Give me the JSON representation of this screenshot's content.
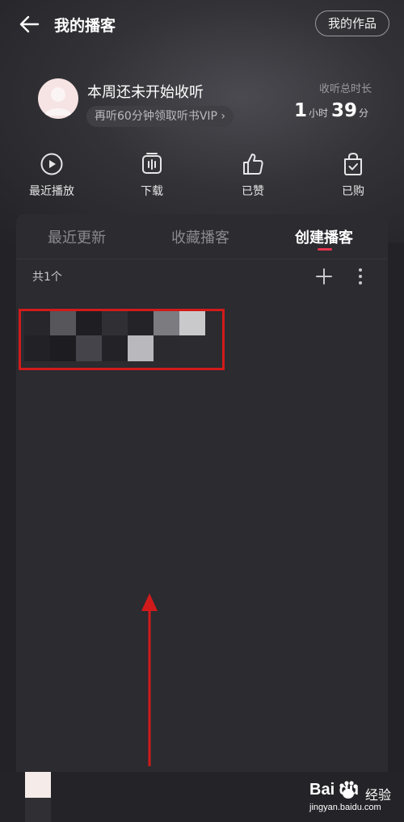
{
  "header": {
    "title": "我的播客",
    "works_button": "我的作品"
  },
  "profile": {
    "listen_title": "本周还未开始收听",
    "vip_promo": "再听60分钟领取听书VIP",
    "vip_chevron": "›",
    "total_label": "收听总时长",
    "hours": "1",
    "hours_unit": "小时",
    "minutes": "39",
    "minutes_unit": "分"
  },
  "quick_actions": [
    {
      "label": "最近播放",
      "icon": "play-circle-icon"
    },
    {
      "label": "下载",
      "icon": "download-icon"
    },
    {
      "label": "已赞",
      "icon": "thumbs-up-icon"
    },
    {
      "label": "已购",
      "icon": "purchased-bag-icon"
    }
  ],
  "tabs": [
    {
      "label": "最近更新",
      "active": false
    },
    {
      "label": "收藏播客",
      "active": false
    },
    {
      "label": "创建播客",
      "active": true
    }
  ],
  "list": {
    "count_label": "共1个"
  },
  "colors": {
    "accent": "#e8344e",
    "highlight_box": "#d11b1b",
    "background": "#232327",
    "panel": "#2b2b30"
  },
  "watermark": {
    "brand": "Bai  du",
    "brand_suffix": "经验",
    "url": "jingyan.baidu.com"
  }
}
